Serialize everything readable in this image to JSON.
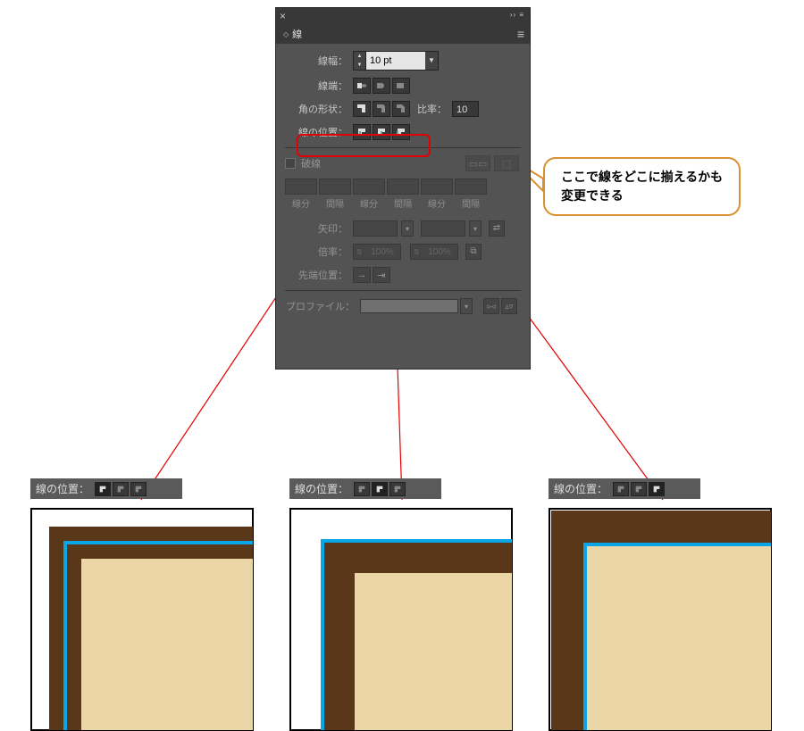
{
  "panel": {
    "title": "線",
    "stroke_width": {
      "label": "線幅：",
      "value": "10 pt"
    },
    "cap": {
      "label": "線端："
    },
    "corner": {
      "label": "角の形状：",
      "ratio_label": "比率：",
      "ratio_value": "10"
    },
    "align": {
      "label": "線の位置："
    },
    "dashed": {
      "label": "破線",
      "cols": [
        "線分",
        "間隔",
        "線分",
        "間隔",
        "線分",
        "間隔"
      ]
    },
    "arrow": {
      "label": "矢印："
    },
    "scale": {
      "label": "倍率：",
      "value": "100%"
    },
    "tip": {
      "label": "先端位置："
    },
    "profile": {
      "label": "プロファイル："
    }
  },
  "callout": {
    "line1": "ここで線をどこに揃えるかも",
    "line2": "変更できる"
  },
  "example_label": "線の位置："
}
